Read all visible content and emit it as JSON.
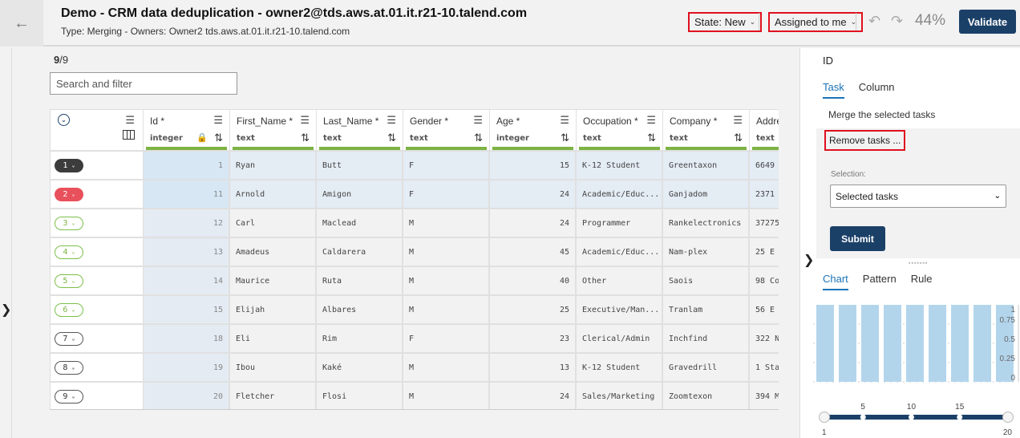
{
  "header": {
    "back_icon": "arrow-left-icon",
    "title": "Demo - CRM data deduplication - owner2@tds.aws.at.01.it.r21-10.talend.com",
    "subtitle": "Type: Merging - Owners: Owner2 tds.aws.at.01.it.r21-10.talend.com",
    "state_filter": "State: New",
    "assignee_filter": "Assigned to me",
    "undo_icon": "undo-icon",
    "redo_icon": "redo-icon",
    "progress": "44%",
    "validate_label": "Validate"
  },
  "toolbar": {
    "count_current": "9",
    "count_total": "/9",
    "search_placeholder": "Search and filter"
  },
  "grid": {
    "columns": [
      {
        "name": "Id *",
        "type": "integer",
        "locked": true
      },
      {
        "name": "First_Name *",
        "type": "text"
      },
      {
        "name": "Last_Name *",
        "type": "text"
      },
      {
        "name": "Gender *",
        "type": "text"
      },
      {
        "name": "Age *",
        "type": "integer"
      },
      {
        "name": "Occupation *",
        "type": "text"
      },
      {
        "name": "Company *",
        "type": "text"
      },
      {
        "name": "Addre",
        "type": "text"
      }
    ],
    "rows": [
      {
        "badge": "1",
        "style": "dark",
        "selected": true,
        "cells": [
          "1",
          "Ryan",
          "Butt",
          "F",
          "15",
          "K-12 Student",
          "Greentaxon",
          "6649"
        ]
      },
      {
        "badge": "2",
        "style": "red",
        "selected": true,
        "cells": [
          "11",
          "Arnold",
          "Amigon",
          "F",
          "24",
          "Academic/Educ...",
          "Ganjadom",
          "2371"
        ]
      },
      {
        "badge": "3",
        "style": "green",
        "selected": false,
        "cells": [
          "12",
          "Carl",
          "Maclead",
          "M",
          "24",
          "Programmer",
          "Rankelectronics",
          "37275"
        ]
      },
      {
        "badge": "4",
        "style": "green",
        "selected": false,
        "cells": [
          "13",
          "Amadeus",
          "Caldarera",
          "M",
          "45",
          "Academic/Educ...",
          "Nam-plex",
          "25 E"
        ]
      },
      {
        "badge": "5",
        "style": "green",
        "selected": false,
        "cells": [
          "14",
          "Maurice",
          "Ruta",
          "M",
          "40",
          "Other",
          "Saois",
          "98 Co"
        ]
      },
      {
        "badge": "6",
        "style": "green",
        "selected": false,
        "cells": [
          "15",
          "Elijah",
          "Albares",
          "M",
          "25",
          "Executive/Man...",
          "Tranlam",
          "56 E"
        ]
      },
      {
        "badge": "7",
        "style": "grey",
        "selected": false,
        "cells": [
          "18",
          "Eli",
          "Rim",
          "F",
          "23",
          "Clerical/Admin",
          "Inchfind",
          "322 N"
        ]
      },
      {
        "badge": "8",
        "style": "grey",
        "selected": false,
        "cells": [
          "19",
          "Ibou",
          "Kaké",
          "M",
          "13",
          "K-12 Student",
          "Gravedrill",
          "1 Sta"
        ]
      },
      {
        "badge": "9",
        "style": "grey",
        "selected": false,
        "cells": [
          "20",
          "Fletcher",
          "Flosi",
          "M",
          "24",
          "Sales/Marketing",
          "Zoomtexon",
          "394 M"
        ]
      }
    ]
  },
  "panel": {
    "title": "ID",
    "tabs": [
      "Task",
      "Column"
    ],
    "active_tab": "Task",
    "merge_label": "Merge the selected tasks",
    "remove_label": "Remove tasks ...",
    "selection_label": "Selection:",
    "selection_value": "Selected tasks",
    "submit_label": "Submit",
    "bottom_tabs": [
      "Chart",
      "Pattern",
      "Rule"
    ],
    "bottom_active_tab": "Chart"
  },
  "chart_data": {
    "type": "bar",
    "values": [
      1,
      1,
      1,
      1,
      1,
      1,
      1,
      1,
      1
    ],
    "ylim": [
      0,
      1
    ],
    "yticks": [
      "0",
      "0.25",
      "0.5",
      "0.75",
      "1"
    ],
    "bar_color": "#b3d5ec",
    "range_slider": {
      "min": 1,
      "max": 20,
      "low": 1,
      "high": 20,
      "ticks": [
        "5",
        "10",
        "15"
      ]
    }
  }
}
